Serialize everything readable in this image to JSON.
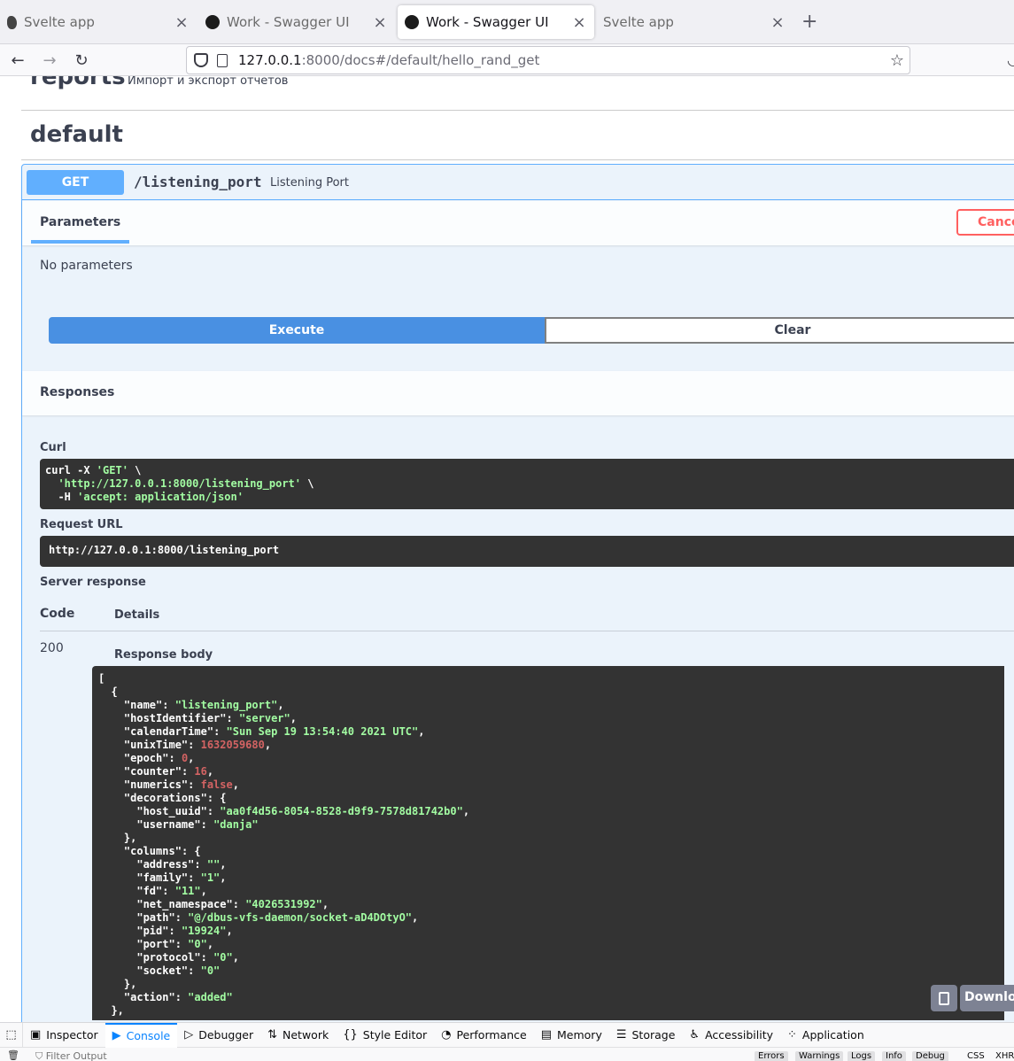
{
  "browser": {
    "tabs": [
      {
        "title": "Svelte app",
        "icon": "svelte-icon",
        "active": false
      },
      {
        "title": "Work - Swagger UI",
        "icon": "bolt-icon",
        "active": false
      },
      {
        "title": "Work - Swagger UI",
        "icon": "bolt-icon",
        "active": true
      },
      {
        "title": "Svelte app",
        "icon": "none",
        "active": false
      }
    ],
    "close_glyph": "×",
    "new_tab_glyph": "+",
    "url_host": "127.0.0.1",
    "url_rest": ":8000/docs#/default/hello_rand_get"
  },
  "swagger": {
    "reports_tag": "reports",
    "reports_desc": "Импорт и экспорт отчетов",
    "default_tag": "default",
    "method": "GET",
    "path": "/listening_port",
    "summary": "Listening Port",
    "parameters_tab": "Parameters",
    "cancel_label": "Cance",
    "no_parameters": "No parameters",
    "execute_label": "Execute",
    "clear_label": "Clear",
    "responses_label": "Responses",
    "curl_label": "Curl",
    "curl_lines": [
      {
        "plain": "curl -X ",
        "str": "'GET'",
        "tail": " \\"
      },
      {
        "plain": "  ",
        "str": "'http://127.0.0.1:8000/listening_port'",
        "tail": " \\"
      },
      {
        "plain": "  -H ",
        "str": "'accept: application/json'",
        "tail": ""
      }
    ],
    "request_url_label": "Request URL",
    "request_url": "http://127.0.0.1:8000/listening_port",
    "server_response_label": "Server response",
    "code_header": "Code",
    "details_header": "Details",
    "status_code": "200",
    "response_body_label": "Response body",
    "download_label": "Downlo",
    "response_lines": [
      {
        "i": "",
        "k": "",
        "p": "[",
        "v": "",
        "t": "",
        "e": ""
      },
      {
        "i": "  ",
        "k": "",
        "p": "{",
        "v": "",
        "t": "",
        "e": ""
      },
      {
        "i": "    ",
        "k": "\"name\"",
        "p": ": ",
        "v": "\"listening_port\"",
        "t": "str",
        "e": ","
      },
      {
        "i": "    ",
        "k": "\"hostIdentifier\"",
        "p": ": ",
        "v": "\"server\"",
        "t": "str",
        "e": ","
      },
      {
        "i": "    ",
        "k": "\"calendarTime\"",
        "p": ": ",
        "v": "\"Sun Sep 19 13:54:40 2021 UTC\"",
        "t": "str",
        "e": ","
      },
      {
        "i": "    ",
        "k": "\"unixTime\"",
        "p": ": ",
        "v": "1632059680",
        "t": "num",
        "e": ","
      },
      {
        "i": "    ",
        "k": "\"epoch\"",
        "p": ": ",
        "v": "0",
        "t": "num",
        "e": ","
      },
      {
        "i": "    ",
        "k": "\"counter\"",
        "p": ": ",
        "v": "16",
        "t": "num",
        "e": ","
      },
      {
        "i": "    ",
        "k": "\"numerics\"",
        "p": ": ",
        "v": "false",
        "t": "num",
        "e": ","
      },
      {
        "i": "    ",
        "k": "\"decorations\"",
        "p": ": {",
        "v": "",
        "t": "",
        "e": ""
      },
      {
        "i": "      ",
        "k": "\"host_uuid\"",
        "p": ": ",
        "v": "\"aa0f4d56-8054-8528-d9f9-7578d81742b0\"",
        "t": "str",
        "e": ","
      },
      {
        "i": "      ",
        "k": "\"username\"",
        "p": ": ",
        "v": "\"danja\"",
        "t": "str",
        "e": ""
      },
      {
        "i": "    ",
        "k": "",
        "p": "},",
        "v": "",
        "t": "",
        "e": ""
      },
      {
        "i": "    ",
        "k": "\"columns\"",
        "p": ": {",
        "v": "",
        "t": "",
        "e": ""
      },
      {
        "i": "      ",
        "k": "\"address\"",
        "p": ": ",
        "v": "\"\"",
        "t": "str",
        "e": ","
      },
      {
        "i": "      ",
        "k": "\"family\"",
        "p": ": ",
        "v": "\"1\"",
        "t": "str",
        "e": ","
      },
      {
        "i": "      ",
        "k": "\"fd\"",
        "p": ": ",
        "v": "\"11\"",
        "t": "str",
        "e": ","
      },
      {
        "i": "      ",
        "k": "\"net_namespace\"",
        "p": ": ",
        "v": "\"4026531992\"",
        "t": "str",
        "e": ","
      },
      {
        "i": "      ",
        "k": "\"path\"",
        "p": ": ",
        "v": "\"@/dbus-vfs-daemon/socket-aD4DOtyO\"",
        "t": "str",
        "e": ","
      },
      {
        "i": "      ",
        "k": "\"pid\"",
        "p": ": ",
        "v": "\"19924\"",
        "t": "str",
        "e": ","
      },
      {
        "i": "      ",
        "k": "\"port\"",
        "p": ": ",
        "v": "\"0\"",
        "t": "str",
        "e": ","
      },
      {
        "i": "      ",
        "k": "\"protocol\"",
        "p": ": ",
        "v": "\"0\"",
        "t": "str",
        "e": ","
      },
      {
        "i": "      ",
        "k": "\"socket\"",
        "p": ": ",
        "v": "\"0\"",
        "t": "str",
        "e": ""
      },
      {
        "i": "    ",
        "k": "",
        "p": "},",
        "v": "",
        "t": "",
        "e": ""
      },
      {
        "i": "    ",
        "k": "\"action\"",
        "p": ": ",
        "v": "\"added\"",
        "t": "str",
        "e": ""
      },
      {
        "i": "  ",
        "k": "",
        "p": "},",
        "v": "",
        "t": "",
        "e": ""
      }
    ]
  },
  "devtools": {
    "tabs": [
      {
        "label": "Inspector",
        "icon": "inspector-icon",
        "glyph": "▣",
        "active": false
      },
      {
        "label": "Console",
        "icon": "console-icon",
        "glyph": "▶",
        "active": true
      },
      {
        "label": "Debugger",
        "icon": "debugger-icon",
        "glyph": "▷",
        "active": false
      },
      {
        "label": "Network",
        "icon": "network-icon",
        "glyph": "⇅",
        "active": false
      },
      {
        "label": "Style Editor",
        "icon": "style-editor-icon",
        "glyph": "{}",
        "active": false
      },
      {
        "label": "Performance",
        "icon": "performance-icon",
        "glyph": "◔",
        "active": false
      },
      {
        "label": "Memory",
        "icon": "memory-icon",
        "glyph": "▤",
        "active": false
      },
      {
        "label": "Storage",
        "icon": "storage-icon",
        "glyph": "☰",
        "active": false
      },
      {
        "label": "Accessibility",
        "icon": "accessibility-icon",
        "glyph": "♿",
        "active": false
      },
      {
        "label": "Application",
        "icon": "application-icon",
        "glyph": "⁘",
        "active": false
      }
    ],
    "filter_placeholder": "Filter Output",
    "chips": [
      "Errors",
      "Warnings",
      "Logs",
      "Info",
      "Debug"
    ],
    "extra": [
      "CSS",
      "XHR"
    ]
  },
  "colors": {
    "get_accent": "#61affe",
    "execute_blue": "#4990e2",
    "cancel_red": "#ff6060",
    "code_bg": "#333333",
    "json_string": "#a2fca2",
    "json_number": "#d36363"
  }
}
